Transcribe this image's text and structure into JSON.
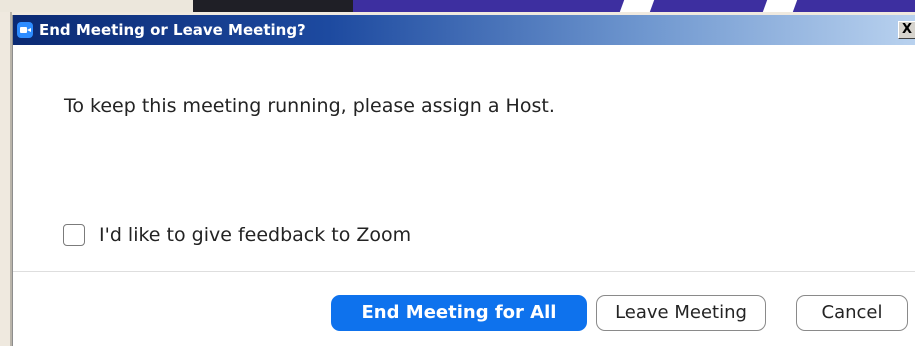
{
  "dialog": {
    "title": "End Meeting or Leave Meeting?",
    "close_symbol": "X",
    "message": "To keep this meeting running, please assign a Host.",
    "feedback_label": "I'd like to give feedback to Zoom",
    "feedback_checked": false
  },
  "buttons": {
    "end_all": "End Meeting for All",
    "leave": "Leave Meeting",
    "cancel": "Cancel"
  },
  "icons": {
    "title_logo": "zoom-camera-icon"
  },
  "colors": {
    "primary_button": "#0e72ed",
    "titlebar_start": "#0b2a73",
    "titlebar_end": "#b9d2ef"
  }
}
